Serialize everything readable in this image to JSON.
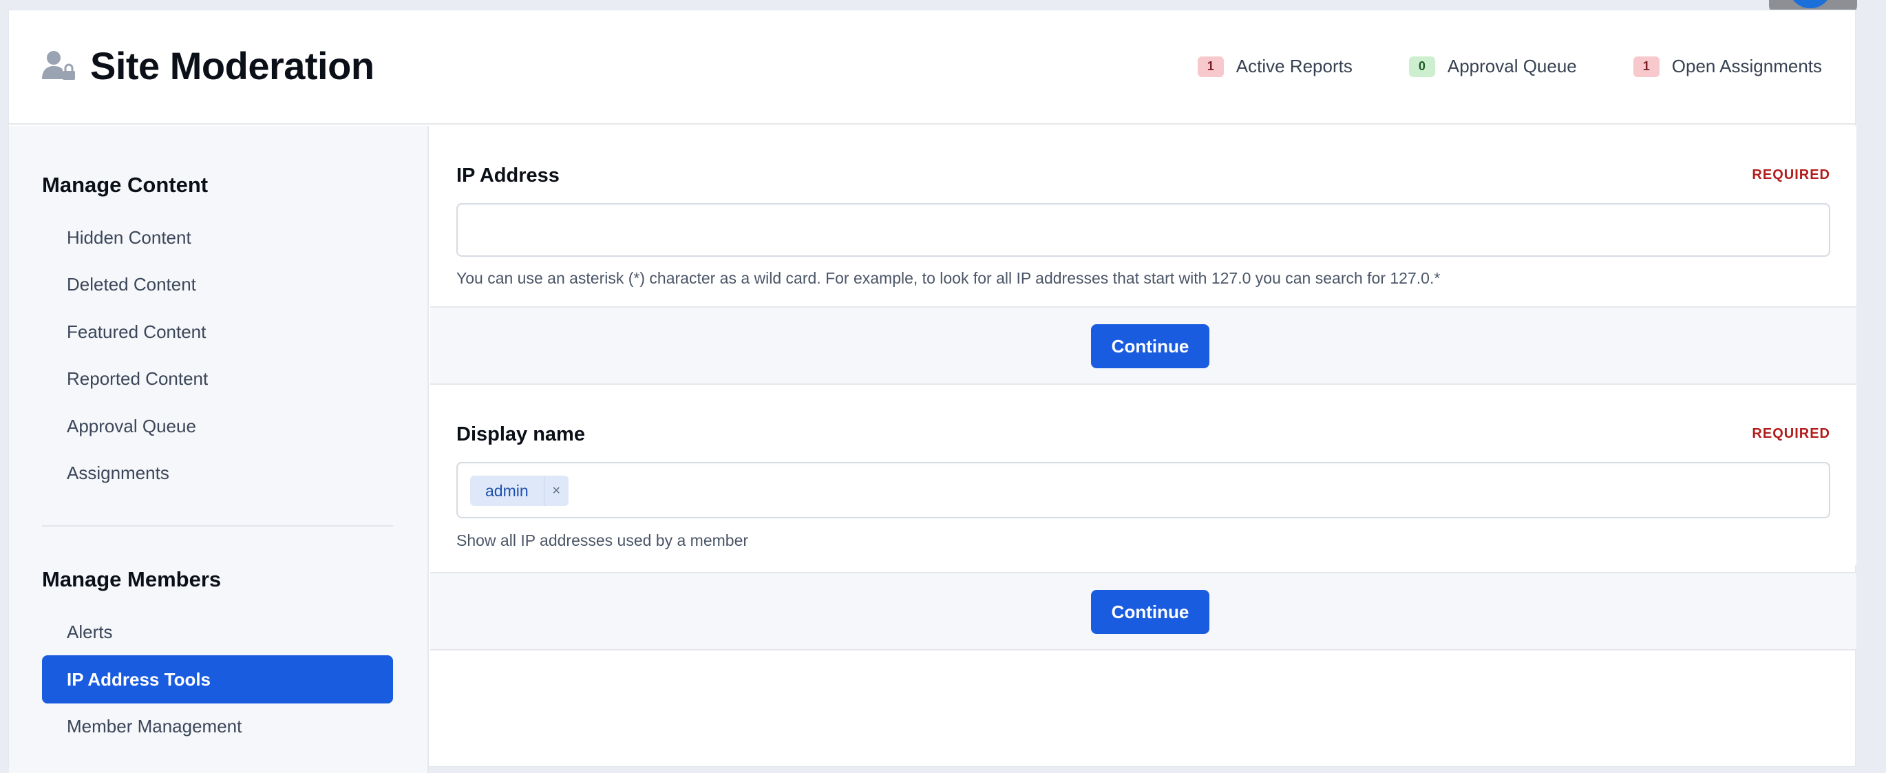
{
  "header": {
    "title": "Site Moderation",
    "icon": "user-lock-icon",
    "stats": [
      {
        "count": "1",
        "label": "Active Reports",
        "color": "#f8c9cc"
      },
      {
        "count": "0",
        "label": "Approval Queue",
        "color": "#cdefd0"
      },
      {
        "count": "1",
        "label": "Open Assignments",
        "color": "#f8c9cc"
      }
    ]
  },
  "sidebar": {
    "sections": [
      {
        "heading": "Manage Content",
        "items": [
          {
            "label": "Hidden Content"
          },
          {
            "label": "Deleted Content"
          },
          {
            "label": "Featured Content"
          },
          {
            "label": "Reported Content"
          },
          {
            "label": "Approval Queue"
          },
          {
            "label": "Assignments"
          }
        ]
      },
      {
        "heading": "Manage Members",
        "items": [
          {
            "label": "Alerts"
          },
          {
            "label": "IP Address Tools",
            "active": true
          },
          {
            "label": "Member Management"
          }
        ]
      }
    ]
  },
  "forms": [
    {
      "label": "IP Address",
      "required": "REQUIRED",
      "value": "",
      "hint": "You can use an asterisk (*) character as a wild card. For example, to look for all IP addresses that start with 127.0 you can search for 127.0.*",
      "button": "Continue"
    },
    {
      "label": "Display name",
      "required": "REQUIRED",
      "token": "admin",
      "token_remove": "×",
      "hint": "Show all IP addresses used by a member",
      "button": "Continue"
    }
  ],
  "colors": {
    "accent": "#1a5ce0",
    "required": "#b31d1d"
  }
}
